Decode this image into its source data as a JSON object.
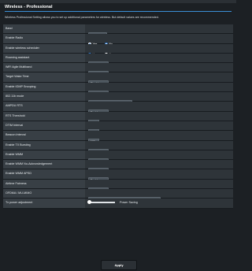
{
  "header": {
    "title": "Wireless - Professional",
    "description": "Wireless Professional Setting allows you to set up additional parameters for wireless. But default values are recommended."
  },
  "settings": [
    {
      "label": "Band",
      "type": "select",
      "value": "2.4 GHz"
    },
    {
      "label": "Enable Radio",
      "type": "radio",
      "options": [
        "Yes",
        "No"
      ],
      "selected": "Yes"
    },
    {
      "label": "Enable wireless scheduler",
      "type": "radio",
      "options": [
        "Yes",
        "No"
      ],
      "selected": "No"
    },
    {
      "label": "Roaming assistant",
      "type": "select",
      "value": "Disable"
    },
    {
      "label": "WiFi Agile Multiband",
      "type": "select",
      "value": "Disable"
    },
    {
      "label": "Target Wake Time",
      "type": "select",
      "value": "Disable"
    },
    {
      "label": "Enable IGMP Snooping",
      "type": "select",
      "value": "Enable"
    },
    {
      "label": "802.11b mode",
      "type": "select",
      "value": "Disable"
    },
    {
      "label": "AMPDU RTS",
      "type": "select",
      "value": "Enable"
    },
    {
      "label": "RTS Threshold",
      "type": "text",
      "value": "2347"
    },
    {
      "label": "DTIM Interval",
      "type": "text",
      "value": "3"
    },
    {
      "label": "Beacon Interval",
      "type": "text",
      "value": "100"
    },
    {
      "label": "Enable TX Bursting",
      "type": "select",
      "value": "Enable"
    },
    {
      "label": "Enable WMM",
      "type": "select",
      "value": "Enable"
    },
    {
      "label": "Enable WMM No-Acknowledgement",
      "type": "select",
      "value": "Disable"
    },
    {
      "label": "Enable WMM APSD",
      "type": "select",
      "value": "Enable"
    },
    {
      "label": "Airtime Fairness",
      "type": "select",
      "value": "Disable"
    },
    {
      "label": "OFDMA / MU-MIMO",
      "type": "select",
      "value": "Disable"
    },
    {
      "label": "Tx power adjustment",
      "type": "slider",
      "value_label": "Power Saving",
      "level": 0
    }
  ],
  "actions": {
    "apply_label": "Apply"
  },
  "colors": {
    "background": "#1c2024",
    "accent": "#3a8fd6",
    "row": "#2e3439",
    "label_col": "#383f45"
  }
}
